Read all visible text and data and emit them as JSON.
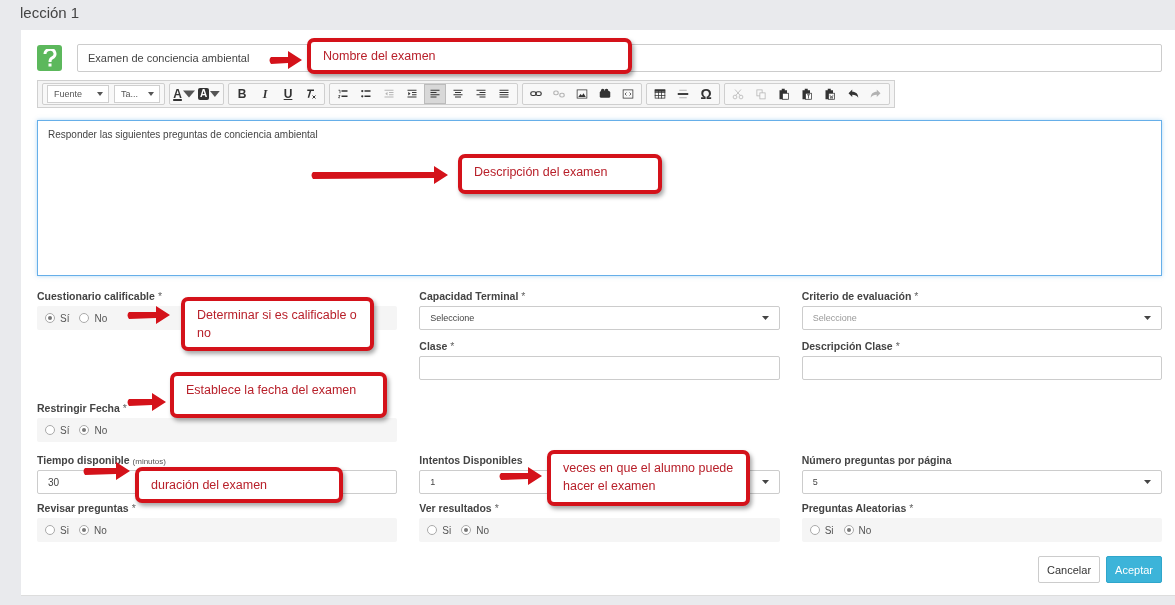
{
  "page_title": "lección 1",
  "exam_name": {
    "value": "Examen de conciencia ambiental"
  },
  "toolbar": [
    [
      {
        "kind": "dropdown",
        "label": "Fuente"
      },
      {
        "kind": "dropdown",
        "label": "Ta..."
      }
    ],
    [
      {
        "kind": "glyph",
        "label": "A",
        "disabled": false,
        "selected": false
      },
      {
        "kind": "glyph",
        "label": "A",
        "disabled": false,
        "selected": false
      }
    ],
    [
      {
        "kind": "glyph",
        "label": "B",
        "disabled": false,
        "selected": false
      },
      {
        "kind": "glyph",
        "label": "I",
        "disabled": false,
        "selected": false
      },
      {
        "kind": "glyph",
        "label": "U",
        "disabled": false,
        "selected": false
      },
      {
        "kind": "icon",
        "disabled": false,
        "selected": false
      }
    ],
    [
      {
        "kind": "icon",
        "disabled": false,
        "selected": false
      },
      {
        "kind": "icon",
        "disabled": false,
        "selected": false
      },
      {
        "kind": "icon",
        "disabled": true,
        "selected": false
      },
      {
        "kind": "icon",
        "disabled": false,
        "selected": false
      },
      {
        "kind": "icon",
        "disabled": false,
        "selected": true
      },
      {
        "kind": "icon",
        "disabled": false,
        "selected": false
      },
      {
        "kind": "icon",
        "disabled": false,
        "selected": false
      },
      {
        "kind": "icon",
        "disabled": false,
        "selected": false
      }
    ],
    [
      {
        "kind": "icon",
        "disabled": false,
        "selected": false
      },
      {
        "kind": "icon",
        "disabled": true,
        "selected": false
      },
      {
        "kind": "icon",
        "disabled": false,
        "selected": false
      },
      {
        "kind": "icon",
        "disabled": false,
        "selected": false
      },
      {
        "kind": "icon",
        "disabled": false,
        "selected": false
      }
    ],
    [
      {
        "kind": "icon",
        "disabled": false,
        "selected": false
      },
      {
        "kind": "icon",
        "disabled": false,
        "selected": false
      },
      {
        "kind": "glyph",
        "label": "Ω",
        "disabled": false,
        "selected": false
      }
    ],
    [
      {
        "kind": "icon",
        "disabled": true,
        "selected": false
      },
      {
        "kind": "icon",
        "disabled": true,
        "selected": false
      },
      {
        "kind": "icon",
        "disabled": false,
        "selected": false
      },
      {
        "kind": "icon",
        "disabled": false,
        "selected": false
      },
      {
        "kind": "icon",
        "disabled": false,
        "selected": false
      },
      {
        "kind": "icon",
        "disabled": false,
        "selected": false
      },
      {
        "kind": "icon",
        "disabled": true,
        "selected": false
      }
    ]
  ],
  "description": {
    "value": "Responder las siguientes preguntas de conciencia ambiental"
  },
  "upper_columns": [
    [
      {
        "kind": "radio",
        "label": "Cuestionario calificable",
        "required_mark": "*",
        "options": [
          {
            "label": "Sí",
            "selected": true
          },
          {
            "label": "No",
            "selected": false
          }
        ]
      },
      {
        "kind": "radio",
        "label": "Restringir Fecha",
        "required_mark": "*",
        "options": [
          {
            "label": "Sí",
            "selected": false
          },
          {
            "label": "No",
            "selected": true
          }
        ]
      }
    ],
    [
      {
        "kind": "select",
        "label": "Capacidad Terminal",
        "required_mark": "*",
        "value": "Seleccione"
      },
      {
        "kind": "text",
        "label": "Clase",
        "required_mark": "*"
      }
    ],
    [
      {
        "kind": "select",
        "label": "Criterio de evaluación",
        "required_mark": "*",
        "placeholder": "Seleccione"
      },
      {
        "kind": "text",
        "label": "Descripción Clase",
        "required_mark": "*"
      }
    ]
  ],
  "lower_rows": [
    [
      {
        "kind": "text",
        "label": "Tiempo disponible",
        "hint": "(minutos)",
        "value": "30"
      },
      {
        "kind": "select",
        "label": "Intentos Disponibles",
        "value": "1"
      },
      {
        "kind": "select",
        "label": "Número preguntas por página",
        "value": "5"
      }
    ],
    [
      {
        "kind": "radio",
        "label": "Revisar preguntas",
        "required_mark": "*",
        "options": [
          {
            "label": "Si",
            "selected": false
          },
          {
            "label": "No",
            "selected": true
          }
        ]
      },
      {
        "kind": "radio",
        "label": "Ver resultados",
        "required_mark": "*",
        "options": [
          {
            "label": "Si",
            "selected": false
          },
          {
            "label": "No",
            "selected": true
          }
        ]
      },
      {
        "kind": "radio",
        "label": "Preguntas Aleatorias",
        "required_mark": "*",
        "options": [
          {
            "label": "Si",
            "selected": false
          },
          {
            "label": "No",
            "selected": true
          }
        ]
      }
    ]
  ],
  "buttons": [
    {
      "kind": "secondary",
      "label": "Cancelar"
    },
    {
      "kind": "primary",
      "label": "Aceptar"
    }
  ],
  "callouts": [
    {
      "text": "Nombre del examen"
    },
    {
      "text": "Descripción del examen"
    },
    {
      "text": "Determinar si es calificable o no"
    },
    {
      "text": "Establece la fecha del examen"
    },
    {
      "text": "duración del examen"
    },
    {
      "text": "veces en que el alumno puede hacer el examen"
    }
  ]
}
